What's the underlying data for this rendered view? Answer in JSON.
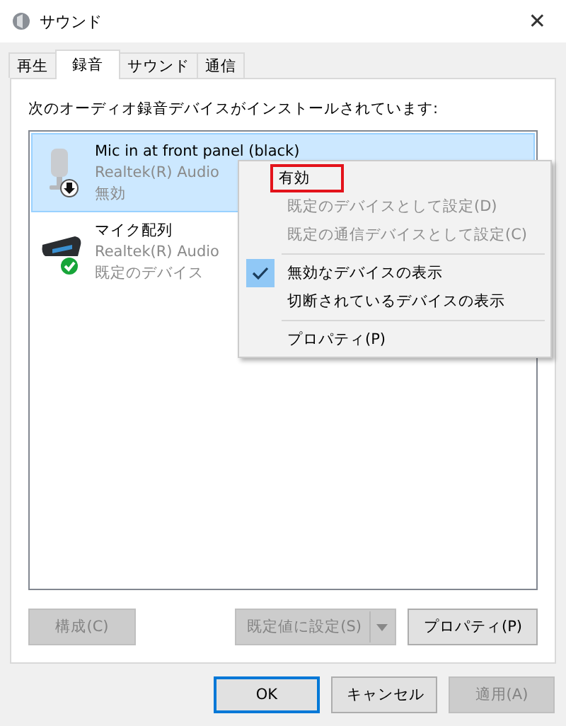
{
  "window": {
    "title": "サウンド",
    "close": "✕"
  },
  "tabs": [
    {
      "label": "再生",
      "selected": false
    },
    {
      "label": "録音",
      "selected": true
    },
    {
      "label": "サウンド",
      "selected": false
    },
    {
      "label": "通信",
      "selected": false
    }
  ],
  "instruction": "次のオーディオ録音デバイスがインストールされています:",
  "devices": [
    {
      "name": "Mic in at front panel (black)",
      "driver": "Realtek(R) Audio",
      "status": "無効",
      "selected": true,
      "kind": "microphone",
      "disabled": true,
      "default": false
    },
    {
      "name": "マイク配列",
      "driver": "Realtek(R) Audio",
      "status": "既定のデバイス",
      "selected": false,
      "kind": "array",
      "disabled": false,
      "default": true
    }
  ],
  "context_menu": [
    {
      "kind": "item",
      "label": "有効",
      "disabled": false,
      "checked": false,
      "annotated": true
    },
    {
      "kind": "item",
      "label": "既定のデバイスとして設定(D)",
      "disabled": true,
      "checked": false,
      "annotated": false
    },
    {
      "kind": "item",
      "label": "既定の通信デバイスとして設定(C)",
      "disabled": true,
      "checked": false,
      "annotated": false
    },
    {
      "kind": "separator"
    },
    {
      "kind": "item",
      "label": "無効なデバイスの表示",
      "disabled": false,
      "checked": true,
      "annotated": false
    },
    {
      "kind": "item",
      "label": "切断されているデバイスの表示",
      "disabled": false,
      "checked": false,
      "annotated": false
    },
    {
      "kind": "separator"
    },
    {
      "kind": "item",
      "label": "プロパティ(P)",
      "disabled": false,
      "checked": false,
      "annotated": false
    }
  ],
  "panel_buttons": {
    "configure": {
      "label": "構成(C)",
      "disabled": true
    },
    "set_default": {
      "label": "既定値に設定(S)",
      "disabled": true
    },
    "properties": {
      "label": "プロパティ(P)",
      "disabled": false
    }
  },
  "dialog_buttons": [
    {
      "label": "OK",
      "disabled": false,
      "default": true
    },
    {
      "label": "キャンセル",
      "disabled": false,
      "default": false
    },
    {
      "label": "適用(A)",
      "disabled": true,
      "default": false
    }
  ]
}
